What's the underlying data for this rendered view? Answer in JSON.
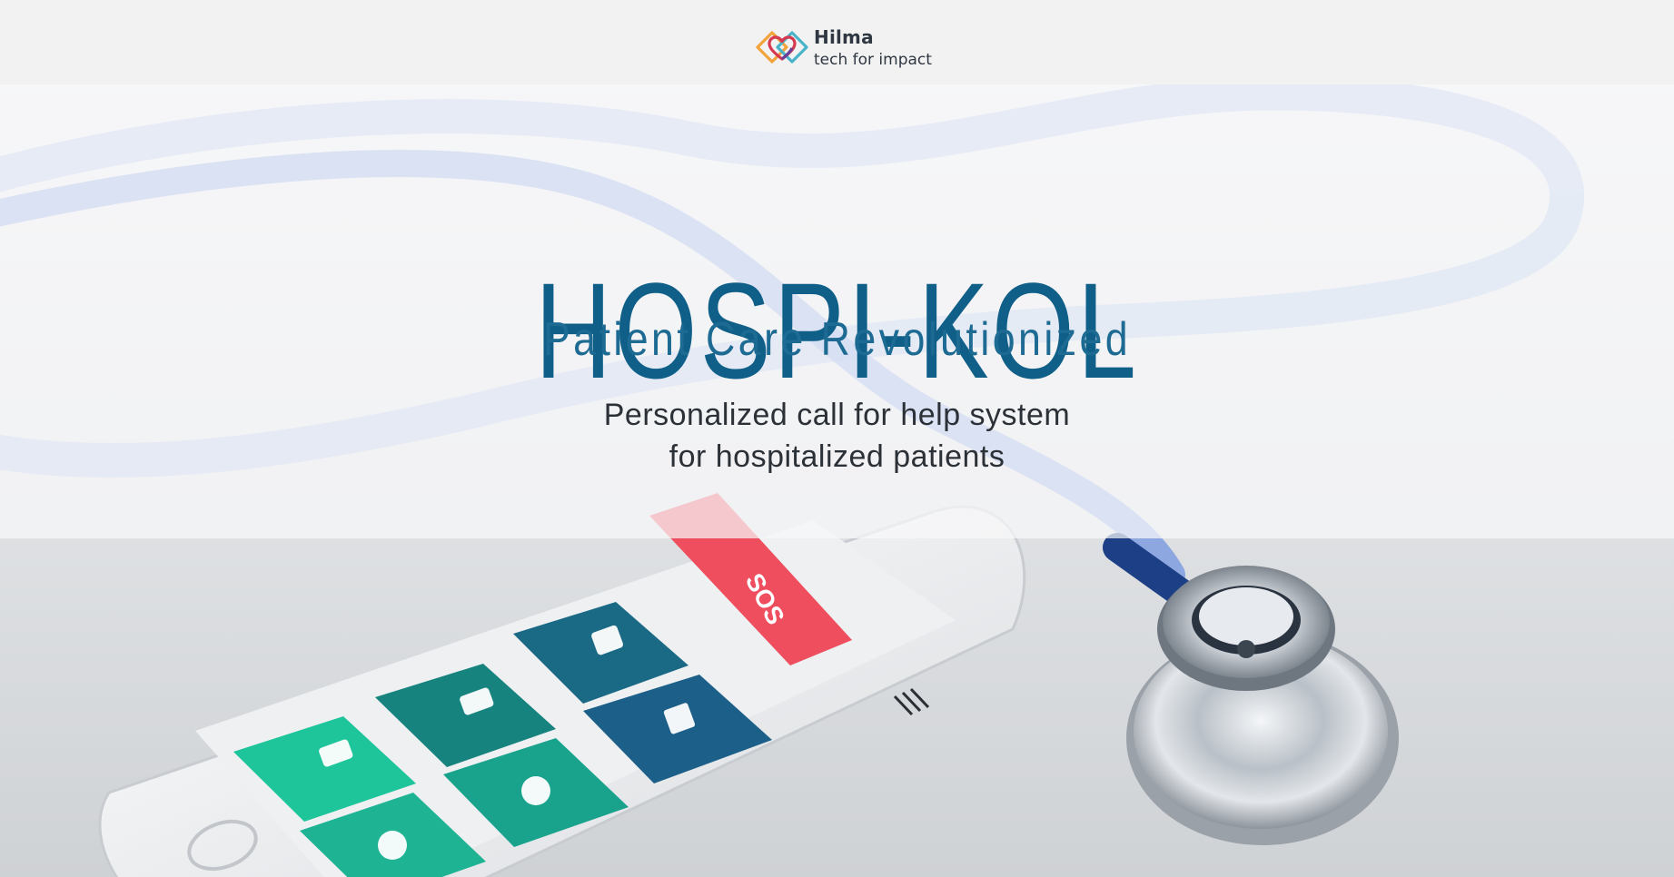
{
  "header": {
    "brand_name": "Hilma",
    "brand_tagline": "tech for impact",
    "logo_icon": "heart-diamond-logo-icon"
  },
  "hero": {
    "title": "HOSPI-KOL",
    "subtitle": "Patient Care Revolutionized",
    "description_line1": "Personalized call for help system",
    "description_line2": "for hospitalized patients",
    "image_icons": [
      "stethoscope-icon",
      "smartphone-icon"
    ]
  },
  "phone_app": {
    "sos_label": "SOS",
    "menu_icon": "hamburger-menu-icon",
    "tiles": [
      {
        "icon": "shirt-icon",
        "color": "#1a6a86"
      },
      {
        "icon": "pills-icon",
        "color": "#17837f"
      },
      {
        "icon": "pills-icon",
        "color": "#1ec49a"
      },
      {
        "icon": "towel-icon",
        "color": "#1c5f88"
      },
      {
        "icon": "nurse-icon",
        "color": "#19a38c"
      },
      {
        "icon": "nurse-icon",
        "color": "#1db393"
      }
    ]
  },
  "colors": {
    "title": "#0f5f88",
    "subtitle": "#1d6a93",
    "text": "#2c3138",
    "sos": "#ee4e5d",
    "header_bg": "#f2f2f2"
  }
}
